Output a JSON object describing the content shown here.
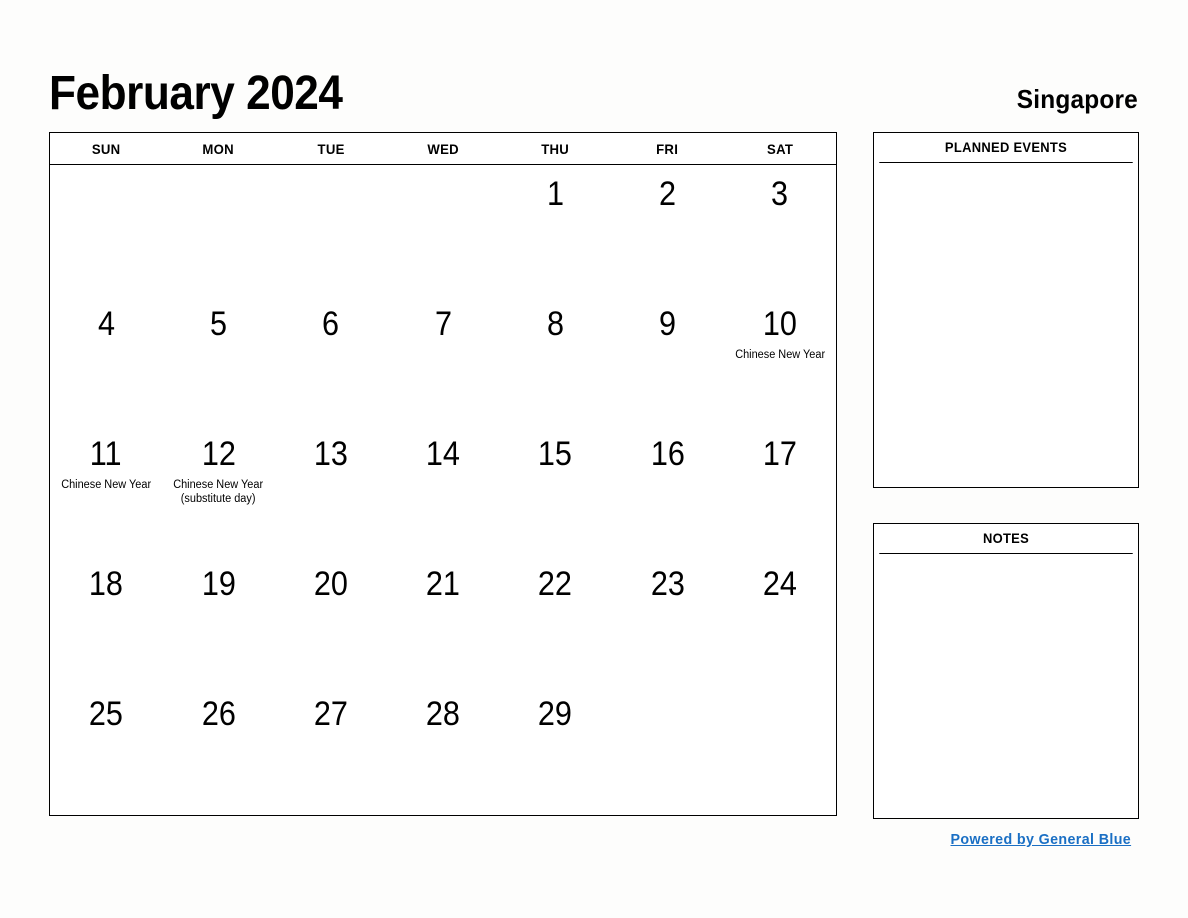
{
  "header": {
    "month_title": "February 2024",
    "country": "Singapore"
  },
  "calendar": {
    "day_headers": [
      "SUN",
      "MON",
      "TUE",
      "WED",
      "THU",
      "FRI",
      "SAT"
    ],
    "weeks": [
      [
        {
          "day": "",
          "events": []
        },
        {
          "day": "",
          "events": []
        },
        {
          "day": "",
          "events": []
        },
        {
          "day": "",
          "events": []
        },
        {
          "day": "1",
          "events": []
        },
        {
          "day": "2",
          "events": []
        },
        {
          "day": "3",
          "events": []
        }
      ],
      [
        {
          "day": "4",
          "events": []
        },
        {
          "day": "5",
          "events": []
        },
        {
          "day": "6",
          "events": []
        },
        {
          "day": "7",
          "events": []
        },
        {
          "day": "8",
          "events": []
        },
        {
          "day": "9",
          "events": []
        },
        {
          "day": "10",
          "events": [
            "Chinese New Year"
          ]
        }
      ],
      [
        {
          "day": "11",
          "events": [
            "Chinese New Year"
          ]
        },
        {
          "day": "12",
          "events": [
            "Chinese New Year (substitute day)"
          ]
        },
        {
          "day": "13",
          "events": []
        },
        {
          "day": "14",
          "events": []
        },
        {
          "day": "15",
          "events": []
        },
        {
          "day": "16",
          "events": []
        },
        {
          "day": "17",
          "events": []
        }
      ],
      [
        {
          "day": "18",
          "events": []
        },
        {
          "day": "19",
          "events": []
        },
        {
          "day": "20",
          "events": []
        },
        {
          "day": "21",
          "events": []
        },
        {
          "day": "22",
          "events": []
        },
        {
          "day": "23",
          "events": []
        },
        {
          "day": "24",
          "events": []
        }
      ],
      [
        {
          "day": "25",
          "events": []
        },
        {
          "day": "26",
          "events": []
        },
        {
          "day": "27",
          "events": []
        },
        {
          "day": "28",
          "events": []
        },
        {
          "day": "29",
          "events": []
        },
        {
          "day": "",
          "events": []
        },
        {
          "day": "",
          "events": []
        }
      ]
    ]
  },
  "panels": {
    "planned_events": {
      "title": "PLANNED EVENTS",
      "content": ""
    },
    "notes": {
      "title": "NOTES",
      "content": ""
    }
  },
  "footer": {
    "link_text": "Powered by General Blue"
  },
  "colors": {
    "link": "#1a6fc4",
    "border": "#000000",
    "background": "#fdfdfc",
    "text": "#000000"
  }
}
